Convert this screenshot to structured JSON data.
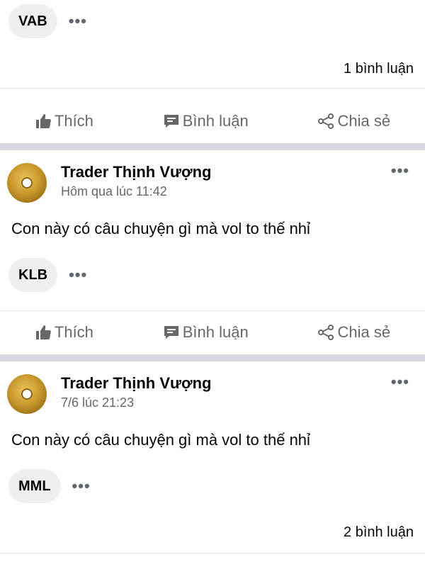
{
  "post0": {
    "tag": "VAB",
    "comments": "1 bình luận"
  },
  "actions": {
    "like": "Thích",
    "comment": "Bình luận",
    "share": "Chia sẻ"
  },
  "post1": {
    "author": "Trader Thịnh Vượng",
    "time": "Hôm qua lúc 11:42",
    "text": "Con này có câu chuyện gì mà vol to thế nhỉ",
    "tag": "KLB"
  },
  "post2": {
    "author": "Trader Thịnh Vượng",
    "time": "7/6 lúc 21:23",
    "text": "Con này có câu chuyện gì mà vol to thế nhỉ",
    "tag": "MML",
    "comments": "2 bình luận"
  },
  "icons": {
    "more": "more-horizontal-icon",
    "like": "thumbs-up-icon",
    "comment": "comment-bubble-icon",
    "share": "share-icon"
  }
}
